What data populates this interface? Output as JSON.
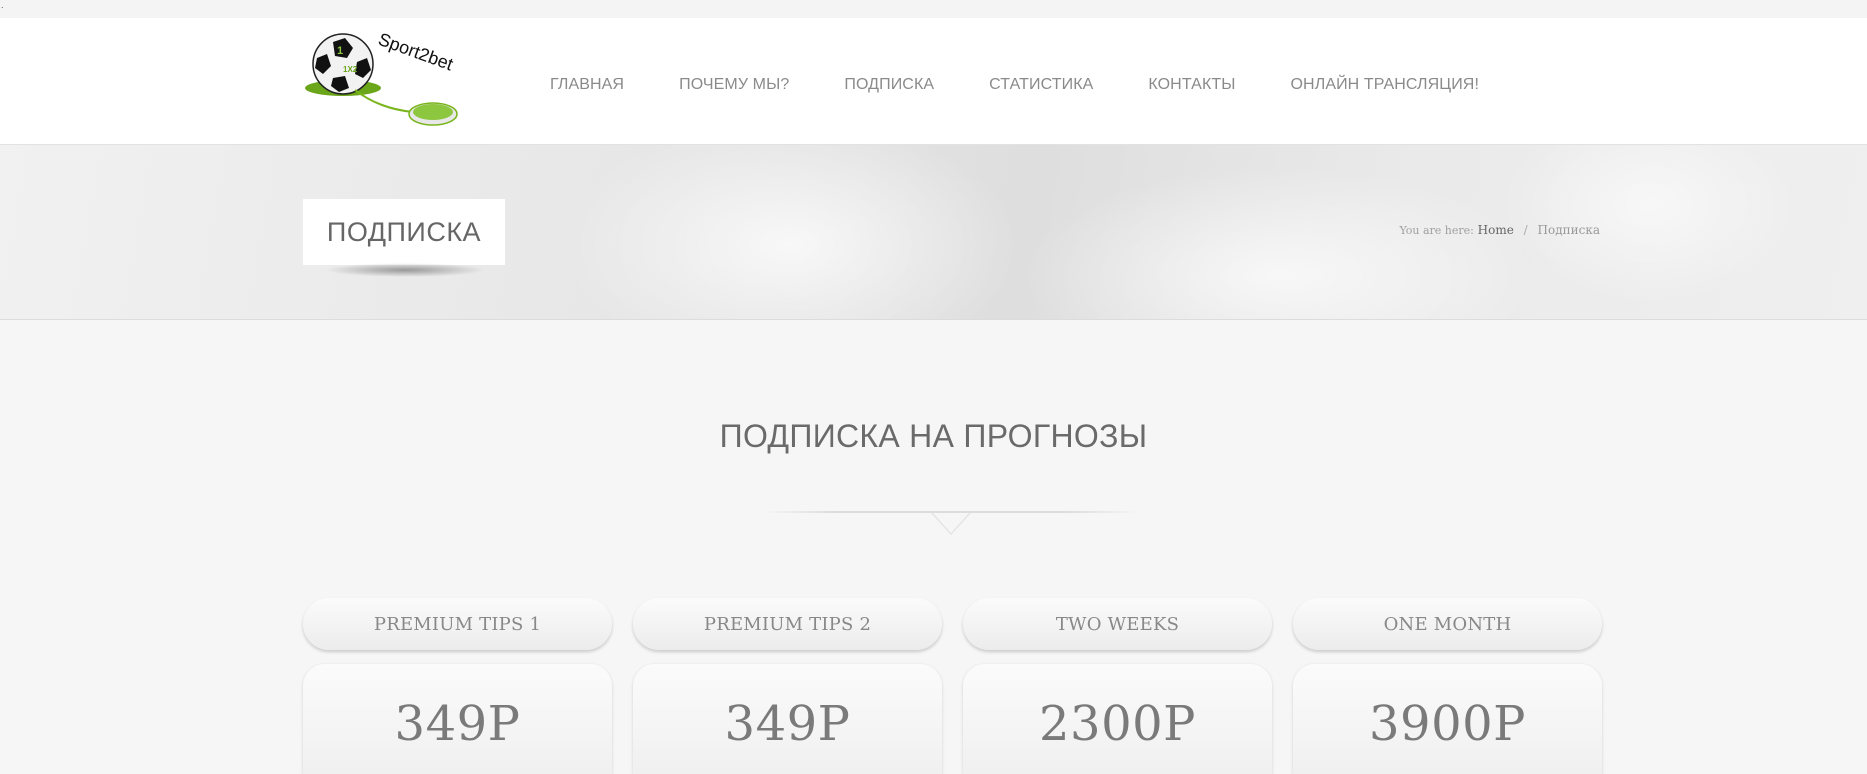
{
  "topbar": {
    "dot": "."
  },
  "header": {
    "logo": {
      "brand_text": "Sport2bet",
      "ball_text": "1X2"
    },
    "nav": [
      {
        "label": "ГЛАВНАЯ"
      },
      {
        "label": "ПОЧЕМУ МЫ?"
      },
      {
        "label": "ПОДПИСКА"
      },
      {
        "label": "СТАТИСТИКА"
      },
      {
        "label": "КОНТАКТЫ"
      },
      {
        "label": "ОНЛАЙН ТРАНСЛЯЦИЯ!"
      }
    ]
  },
  "titlebar": {
    "page_title": "ПОДПИСКА",
    "breadcrumb": {
      "prefix": "You are here:",
      "home": "Home",
      "separator": "/",
      "current": "Подписка"
    }
  },
  "main": {
    "section_title": "ПОДПИСКА НА ПРОГНОЗЫ",
    "plans": [
      {
        "name": "PREMIUM TIPS 1",
        "price": "349Р"
      },
      {
        "name": "PREMIUM TIPS 2",
        "price": "349Р"
      },
      {
        "name": "TWO WEEKS",
        "price": "2300Р"
      },
      {
        "name": "ONE MONTH",
        "price": "3900Р"
      }
    ]
  },
  "colors": {
    "accent_green": "#7ab51d",
    "text_gray": "#777777",
    "background": "#f6f6f6"
  }
}
